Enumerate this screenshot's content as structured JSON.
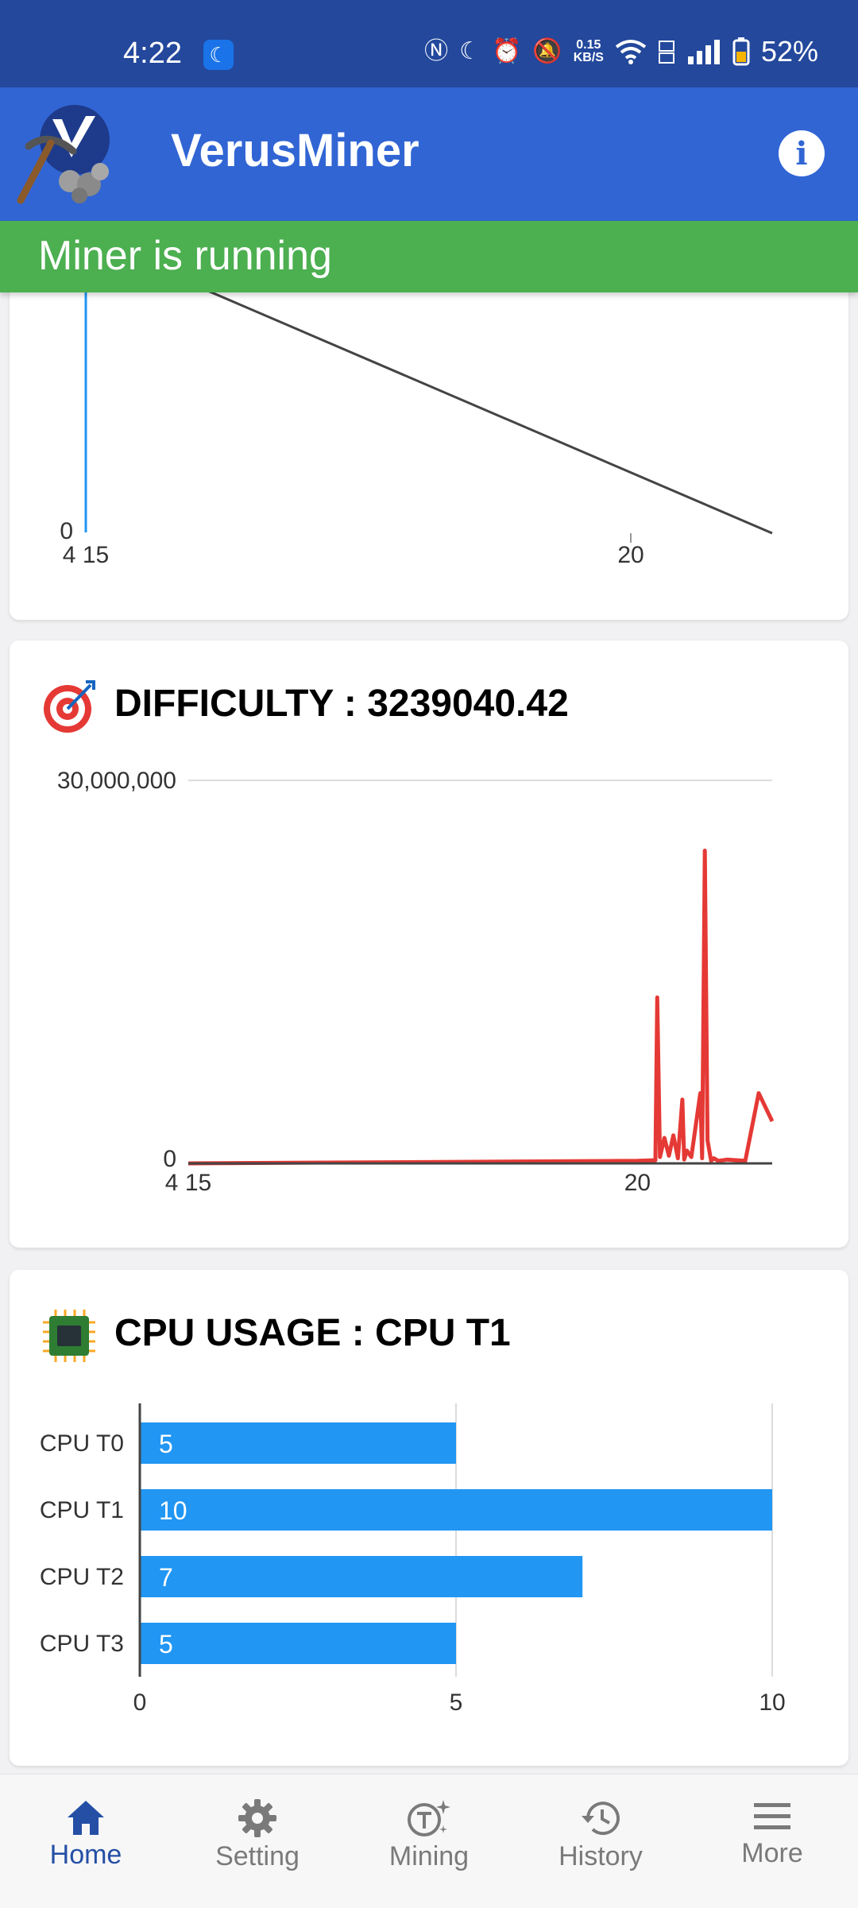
{
  "status_bar": {
    "time": "4:22",
    "net_speed_value": "0.15",
    "net_speed_unit": "KB/S",
    "battery": "52%"
  },
  "app_bar": {
    "title": "VerusMiner",
    "info_icon": "info-icon",
    "brand_color": "#3165d4"
  },
  "banner": {
    "text": "Miner is running",
    "color": "#4caf50"
  },
  "hashrate_card": {
    "chart_data": {
      "type": "line",
      "y_tick_labels": [
        "0"
      ],
      "x_tick_labels": [
        "4 15",
        "20"
      ],
      "color": "#2196f3"
    }
  },
  "difficulty_card": {
    "title": "DIFFICULTY : 3239040.42",
    "icon": "target-icon",
    "chart_data": {
      "type": "line",
      "ylim": [
        0,
        30000000
      ],
      "y_tick_labels": [
        "30,000,000",
        "0"
      ],
      "x_tick_labels": [
        "4 15",
        "20"
      ],
      "x_ticks": [
        15,
        20
      ],
      "x_range": [
        15,
        21.5
      ],
      "color": "#e53935",
      "series": [
        {
          "x": [
            15,
            20.0,
            20.2,
            20.22,
            20.25,
            20.3,
            20.35,
            20.4,
            20.45,
            20.5,
            20.52,
            20.55,
            20.6,
            20.7,
            20.72,
            20.75,
            20.78,
            20.82,
            20.85,
            20.9,
            21.0,
            21.2,
            21.35,
            21.5
          ],
          "y": [
            0,
            200000,
            250000,
            13000000,
            500000,
            2000000,
            600000,
            2200000,
            400000,
            5000000,
            300000,
            1000000,
            500000,
            5500000,
            400000,
            24500000,
            1800000,
            200000,
            400000,
            200000,
            300000,
            200000,
            5500000,
            3300000
          ]
        }
      ]
    }
  },
  "cpu_card": {
    "title": "CPU USAGE : CPU T1",
    "icon": "cpu-chip-icon",
    "chart_data": {
      "type": "bar",
      "orientation": "horizontal",
      "categories": [
        "CPU T0",
        "CPU T1",
        "CPU T2",
        "CPU T3"
      ],
      "values": [
        5,
        10,
        7,
        5
      ],
      "xlim": [
        0,
        10
      ],
      "x_tick_labels": [
        "0",
        "5",
        "10"
      ],
      "color": "#2196f3"
    }
  },
  "bottom_nav": {
    "items": [
      {
        "label": "Home",
        "icon": "home-icon",
        "active": true
      },
      {
        "label": "Setting",
        "icon": "gear-icon",
        "active": false
      },
      {
        "label": "Mining",
        "icon": "mining-icon",
        "active": false
      },
      {
        "label": "History",
        "icon": "history-icon",
        "active": false
      },
      {
        "label": "More",
        "icon": "menu-icon",
        "active": false
      }
    ]
  }
}
